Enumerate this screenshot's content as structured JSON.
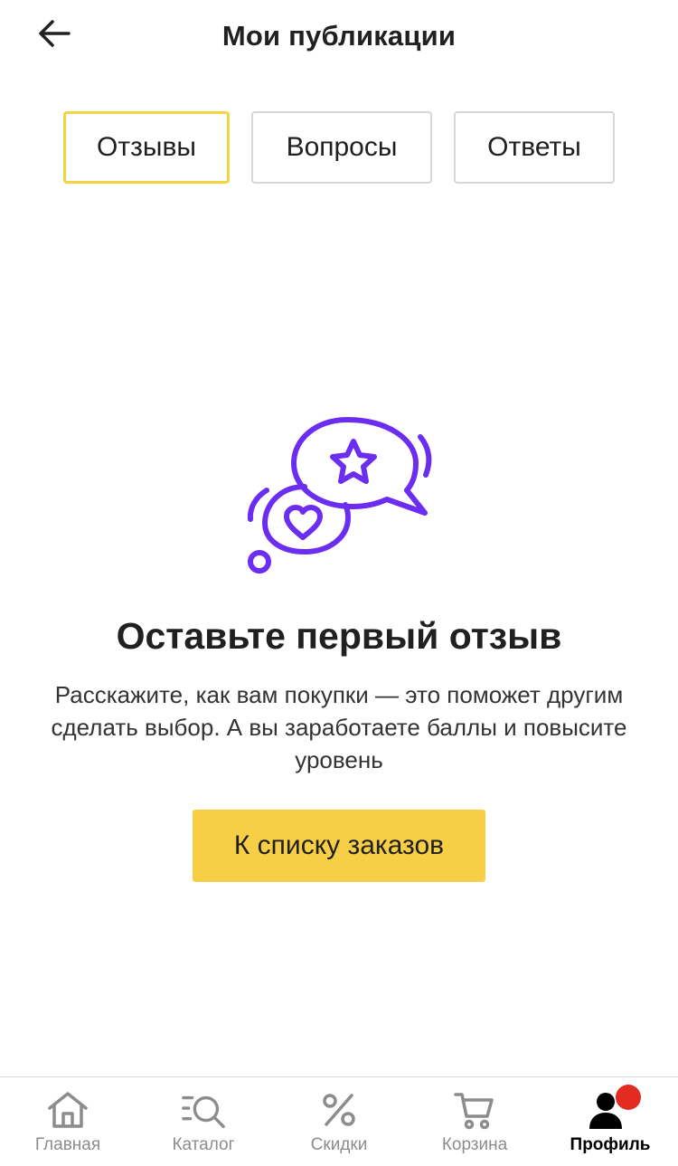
{
  "header": {
    "title": "Мои публикации",
    "back_icon": "arrow-left-icon"
  },
  "tabs": [
    {
      "label": "Отзывы",
      "active": true
    },
    {
      "label": "Вопросы",
      "active": false
    },
    {
      "label": "Ответы",
      "active": false
    }
  ],
  "empty_state": {
    "illustration_icon": "chat-bubbles-star-heart-icon",
    "title": "Оставьте первый отзыв",
    "description": "Расскажите, как вам покупки — это поможет другим сделать выбор. А вы заработаете баллы и повысите уровень",
    "button_label": "К списку заказов"
  },
  "bottom_nav": [
    {
      "label": "Главная",
      "icon": "home-icon",
      "active": false
    },
    {
      "label": "Каталог",
      "icon": "catalog-search-icon",
      "active": false
    },
    {
      "label": "Скидки",
      "icon": "percent-icon",
      "active": false
    },
    {
      "label": "Корзина",
      "icon": "cart-icon",
      "active": false
    },
    {
      "label": "Профиль",
      "icon": "profile-icon",
      "active": true,
      "has_notification": true
    }
  ],
  "colors": {
    "accent_yellow": "#f7cf46",
    "tab_active_border": "#f5d443",
    "illustration_purple": "#6b2df0",
    "notification_red": "#e22b21"
  }
}
